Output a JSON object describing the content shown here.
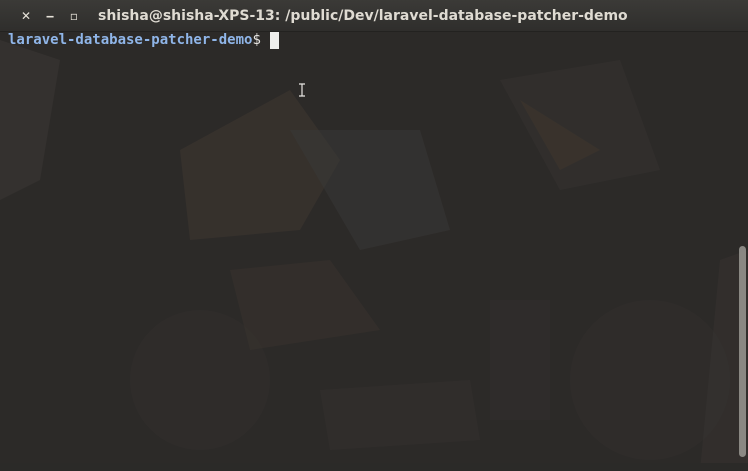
{
  "window": {
    "title": "shisha@shisha-XPS-13: /public/Dev/laravel-database-patcher-demo",
    "close_glyph": "✕",
    "minimize_glyph": "‒",
    "maximize_glyph": "▫"
  },
  "terminal": {
    "prompt_dir": "laravel-database-patcher-demo",
    "prompt_symbol": "$"
  },
  "colors": {
    "prompt_dir": "#8fb5e8",
    "terminal_bg": "#2c2a28",
    "titlebar": "#3b3a37"
  },
  "icons": [
    "close-icon",
    "minimize-icon",
    "maximize-icon",
    "text-cursor-icon"
  ]
}
